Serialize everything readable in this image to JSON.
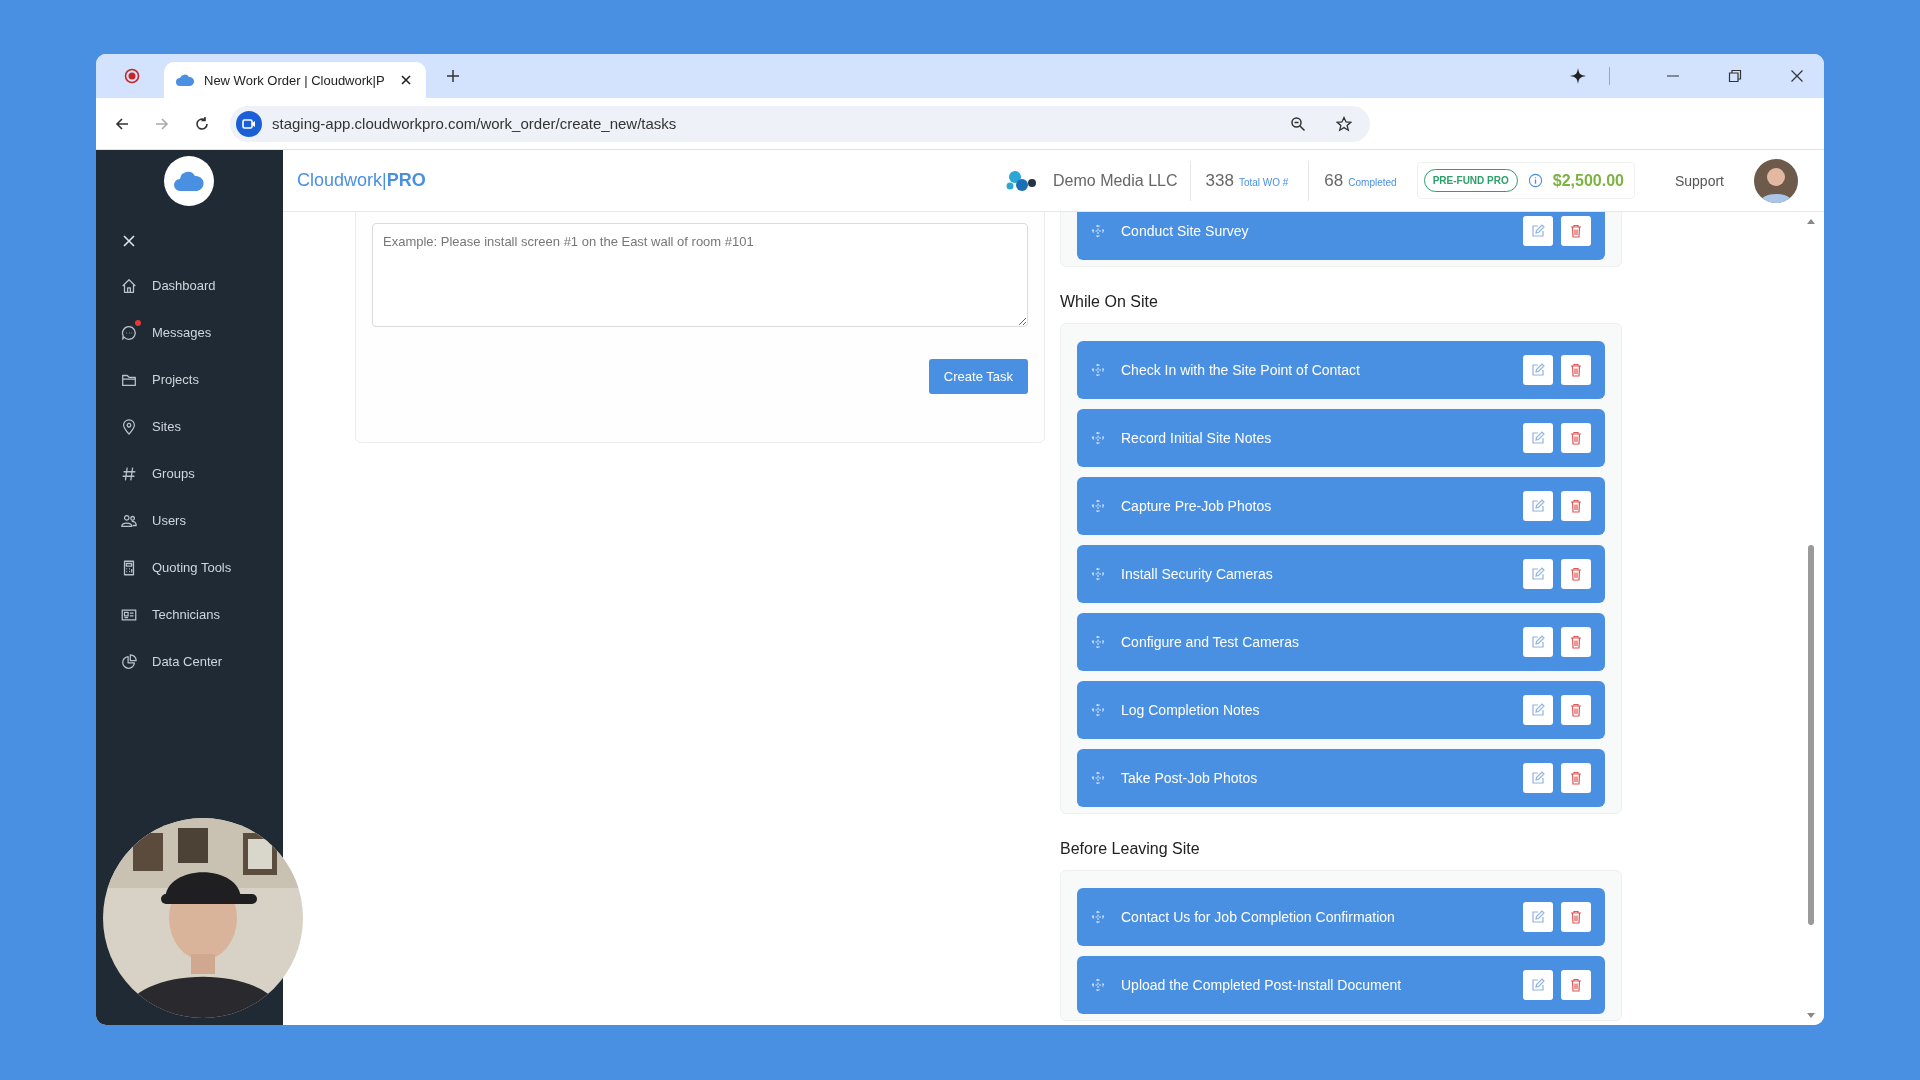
{
  "browser": {
    "tab_title": "New Work Order | Cloudwork|P",
    "url": "staging-app.cloudworkpro.com/work_order/create_new/tasks"
  },
  "brand": {
    "name": "Cloudwork|",
    "suffix": "PRO"
  },
  "header": {
    "company": "Demo Media LLC",
    "stats": [
      {
        "value": "338",
        "label": "Total WO #"
      },
      {
        "value": "68",
        "label": "Completed"
      }
    ],
    "plan_badge": "PRE-FUND PRO",
    "balance": "$2,500.00",
    "support": "Support"
  },
  "sidebar": {
    "items": [
      {
        "label": "Dashboard",
        "notification": false
      },
      {
        "label": "Messages",
        "notification": true
      },
      {
        "label": "Projects",
        "notification": false
      },
      {
        "label": "Sites",
        "notification": false
      },
      {
        "label": "Groups",
        "notification": false
      },
      {
        "label": "Users",
        "notification": false
      },
      {
        "label": "Quoting Tools",
        "notification": false
      },
      {
        "label": "Technicians",
        "notification": false
      },
      {
        "label": "Data Center",
        "notification": false
      }
    ]
  },
  "task_form": {
    "placeholder": "Example: Please install screen #1 on the East wall of room #101",
    "button": "Create Task"
  },
  "sections": [
    {
      "tasks": [
        "Conduct Site Survey"
      ]
    },
    {
      "title": "While On Site",
      "tasks": [
        "Check In with the Site Point of Contact",
        "Record Initial Site Notes",
        "Capture Pre-Job Photos",
        "Install Security Cameras",
        "Configure and Test Cameras",
        "Log Completion Notes",
        "Take Post-Job Photos"
      ]
    },
    {
      "title": "Before Leaving Site",
      "tasks": [
        "Contact Us for Job Completion Confirmation",
        "Upload the Completed Post-Install Document"
      ]
    }
  ]
}
